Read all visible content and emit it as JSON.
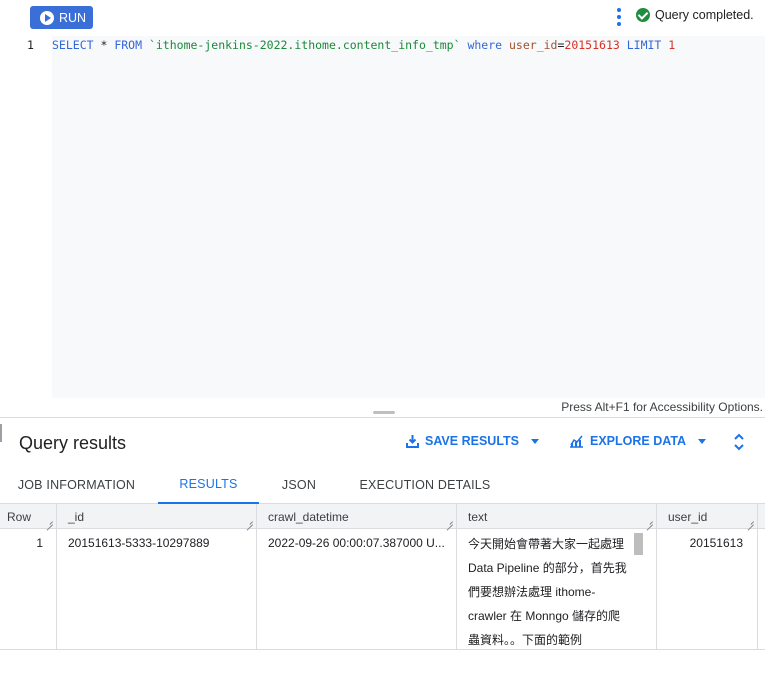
{
  "toolbar": {
    "run_label": "RUN",
    "status_text": "Query completed."
  },
  "editor": {
    "line_number": "1",
    "query_tokens": {
      "select": "SELECT",
      "star": " * ",
      "from": "FROM",
      "table": " `ithome-jenkins-2022.ithome.content_info_tmp` ",
      "where": "where",
      "field": " user_id",
      "eq": "=",
      "value": "20151613",
      "limit": " LIMIT",
      "limit_value": " 1"
    },
    "accessibility_hint": "Press Alt+F1 for Accessibility Options."
  },
  "results": {
    "title": "Query results",
    "save_label": "SAVE RESULTS",
    "explore_label": "EXPLORE DATA"
  },
  "tabs": [
    {
      "label": "JOB INFORMATION"
    },
    {
      "label": "RESULTS"
    },
    {
      "label": "JSON"
    },
    {
      "label": "EXECUTION DETAILS"
    }
  ],
  "table": {
    "headers": [
      "Row",
      "_id",
      "crawl_datetime",
      "text",
      "user_id"
    ],
    "rows": [
      {
        "row": "1",
        "_id": "20151613-5333-10297889",
        "crawl_datetime": "2022-09-26 00:00:07.387000 U...",
        "text": "今天開始會帶著大家一起處理 Data Pipeline 的部分，首先我們要想辦法處理 ithome-crawler 在 Monngo 儲存的爬蟲資料。。下面的範例",
        "user_id": "20151613"
      }
    ]
  },
  "colors": {
    "accent": "#1a73e8",
    "run_button": "#3b6fd8",
    "success": "#1e8e3e"
  }
}
